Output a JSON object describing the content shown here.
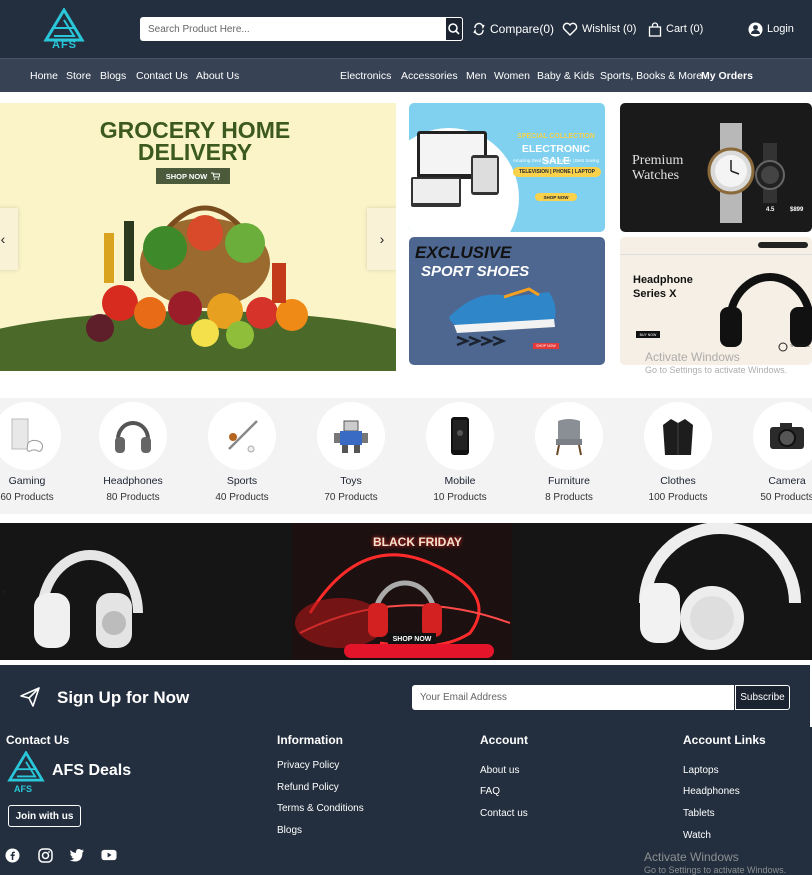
{
  "header": {
    "logo_text": "AFS",
    "search_placeholder": "Search Product Here...",
    "compare_label": "Compare(0)",
    "wishlist_label": "Wishlist (0)",
    "cart_label": "Cart (0)",
    "login_label": "Login"
  },
  "nav": {
    "left": [
      "Home",
      "Store",
      "Blogs",
      "Contact Us",
      "About Us"
    ],
    "right": [
      "Electronics",
      "Accessories",
      "Men",
      "Women",
      "Baby & Kids",
      "Sports, Books & More"
    ],
    "my_orders": "My Orders"
  },
  "hero": {
    "title_line1": "GROCERY HOME",
    "title_line2": "DELIVERY",
    "shop_now": "SHOP NOW",
    "prev_icon": "chevron-left-icon",
    "next_icon": "chevron-right-icon"
  },
  "banners": {
    "electronic": {
      "kicker": "SPECIAL COLLECTION",
      "title": "ELECTRONIC SALE",
      "tagline": "Amazing Deal | Great Brands | Best Saving",
      "tags": "TELEVISION | PHONE | LAPTOP",
      "cta": "SHOP NOW"
    },
    "watches": {
      "title_line1": "Premium",
      "title_line2": "Watches",
      "price": "$899",
      "rating": "4.5"
    },
    "shoes": {
      "title_line1": "EXCLUSIVE",
      "title_line2": "SPORT SHOES",
      "cta": "SHOP NOW"
    },
    "headphone": {
      "title_line1": "Headphone",
      "title_line2": "Series X",
      "cta": "BUY NOW",
      "video_label": "THE DETAIL"
    }
  },
  "categories": [
    {
      "name": "Gaming",
      "count": "60 Products",
      "icon": "game-console-icon"
    },
    {
      "name": "Headphones",
      "count": "80 Products",
      "icon": "headphones-icon"
    },
    {
      "name": "Sports",
      "count": "40 Products",
      "icon": "sports-icon"
    },
    {
      "name": "Toys",
      "count": "70 Products",
      "icon": "toy-robot-icon"
    },
    {
      "name": "Mobile",
      "count": "10 Products",
      "icon": "mobile-phone-icon"
    },
    {
      "name": "Furniture",
      "count": "8 Products",
      "icon": "chair-icon"
    },
    {
      "name": "Clothes",
      "count": "100 Products",
      "icon": "coat-icon"
    },
    {
      "name": "Camera",
      "count": "50 Products",
      "icon": "camera-icon"
    }
  ],
  "black_friday": {
    "title": "BLACK FRIDAY",
    "cta": "SHOP NOW"
  },
  "signup": {
    "title": "Sign Up for Now",
    "placeholder": "Your Email Address",
    "button": "Subscribe"
  },
  "footer": {
    "contact_heading": "Contact Us",
    "brand_name": "AFS Deals",
    "brand_logo_text": "AFS",
    "join_label": "Join with us",
    "information_heading": "Information",
    "information_links": [
      "Privacy Policy",
      "Refund Policy",
      "Terms & Conditions",
      "Blogs"
    ],
    "account_heading": "Account",
    "account_links": [
      "About us",
      "FAQ",
      "Contact us"
    ],
    "account_links_heading": "Account Links",
    "account_links_list": [
      "Laptops",
      "Headphones",
      "Tablets",
      "Watch"
    ],
    "social": [
      "facebook-icon",
      "instagram-icon",
      "twitter-icon",
      "youtube-icon"
    ]
  },
  "watermark": {
    "title": "Activate Windows",
    "subtitle": "Go to Settings to activate Windows."
  },
  "colors": {
    "header_bg": "#232f3e",
    "nav_bg": "#374354",
    "accent_teal": "#29c7d9",
    "black_friday_red": "#e4152b"
  }
}
